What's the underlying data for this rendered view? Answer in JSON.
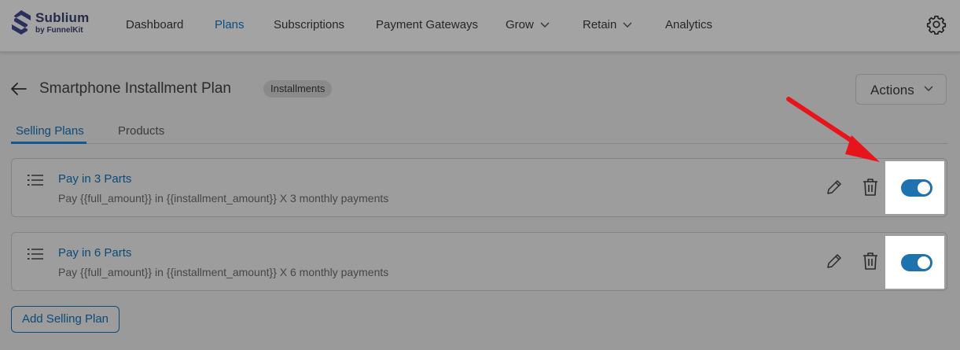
{
  "app": {
    "brand_name": "Sublium",
    "brand_sub": "by FunnelKit"
  },
  "nav": {
    "items": [
      {
        "label": "Dashboard"
      },
      {
        "label": "Plans",
        "active": true
      },
      {
        "label": "Subscriptions"
      },
      {
        "label": "Payment Gateways"
      },
      {
        "label": "Grow",
        "has_dropdown": true
      },
      {
        "label": "Retain",
        "has_dropdown": true
      },
      {
        "label": "Analytics"
      }
    ],
    "settings_icon": "gear-icon"
  },
  "header": {
    "title": "Smartphone Installment Plan",
    "badge": "Installments",
    "actions_label": "Actions"
  },
  "tabs": [
    {
      "label": "Selling Plans",
      "active": true
    },
    {
      "label": "Products",
      "active": false
    }
  ],
  "plans": [
    {
      "name": "Pay in 3 Parts",
      "description": "Pay {{full_amount}} in {{installment_amount}} X 3 monthly payments",
      "enabled": true
    },
    {
      "name": "Pay in 6 Parts",
      "description": "Pay {{full_amount}} in {{installment_amount}} X 6 monthly payments",
      "enabled": true
    }
  ],
  "add_button_label": "Add Selling Plan",
  "colors": {
    "accent": "#1f72b0",
    "link": "#0c4a78",
    "annotation_arrow": "#e8141c"
  }
}
